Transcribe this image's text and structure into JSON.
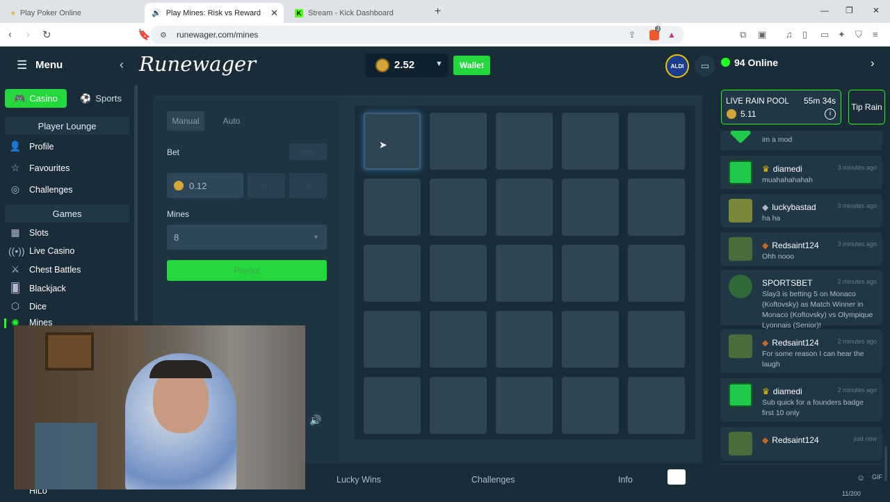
{
  "browser": {
    "tabs": [
      {
        "title": "Play Poker Online",
        "active": false
      },
      {
        "title": "Play Mines: Risk vs Reward - R",
        "active": true
      },
      {
        "title": "Stream - Kick Dashboard",
        "active": false
      }
    ],
    "new_tab": "+",
    "url": "runewager.com/mines",
    "extension_badge": "3"
  },
  "header": {
    "menu_label": "Menu",
    "logo": "Runewager",
    "balance": "2.52",
    "wallet_label": "Wallet",
    "avatar_text": "ALDI",
    "online_count": "94 Online"
  },
  "sidebar": {
    "casino_label": "Casino",
    "sports_label": "Sports",
    "player_lounge": "Player Lounge",
    "lounge_items": [
      "Profile",
      "Favourites",
      "Challenges"
    ],
    "games_header": "Games",
    "game_items": [
      "Slots",
      "Live Casino",
      "Chest Battles",
      "Blackjack",
      "Dice",
      "Mines"
    ],
    "last_item": "HiLo"
  },
  "game": {
    "manual_label": "Manual",
    "auto_label": "Auto",
    "bet_label": "Bet",
    "max_label": "Max",
    "bet_value": "0.12",
    "half_label": "1/2",
    "double_label": "2x",
    "mines_label": "Mines",
    "mines_value": "8",
    "payout_label": "Payout",
    "grid_rows": 5,
    "grid_cols": 5
  },
  "bottom_tabs": [
    "Lucky Wins",
    "Challenges",
    "Info"
  ],
  "chat": {
    "rain_title": "LIVE RAIN POOL",
    "rain_timer": "55m 34s",
    "rain_amount": "5.11",
    "tip_rain_label": "Tip Rain",
    "messages": [
      {
        "user": "",
        "time": "",
        "text": "im a mod"
      },
      {
        "user": "diamedi",
        "time": "3 minutes ago",
        "text": "muahahahahah"
      },
      {
        "user": "luckybastad",
        "time": "3 minutes ago",
        "text": "ha ha"
      },
      {
        "user": "Redsaint124",
        "time": "3 minutes ago",
        "text": "Ohh nooo"
      },
      {
        "user": "SPORTSBET",
        "time": "2 minutes ago",
        "text": "Slay3 is betting 5 on Monaco (Koftovsky) as Match Winner in Monaco (Koftovsky) vs Olympique Lyonnais (Senior)!"
      },
      {
        "user": "Redsaint124",
        "time": "2 minutes ago",
        "text": "For some reason I can hear the laugh"
      },
      {
        "user": "diamedi",
        "time": "2 minutes ago",
        "text": "Sub quick for a founders badge first 10 only"
      },
      {
        "user": "Redsaint124",
        "time": "just now",
        "text": ""
      }
    ],
    "gif_label": "GIF",
    "char_count": "11/200"
  },
  "colors": {
    "accent_green": "#1fff20",
    "bg_dark": "#1a2c38",
    "panel": "#213743",
    "tile": "#2f4553"
  }
}
